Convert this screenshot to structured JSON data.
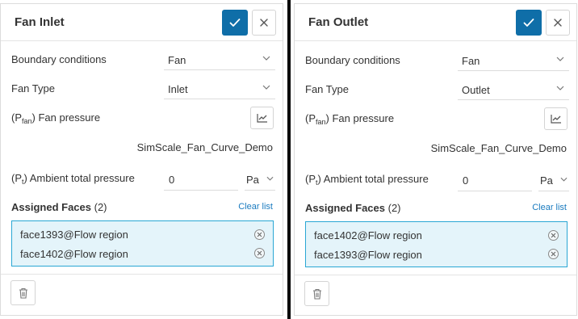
{
  "panels": [
    {
      "title": "Fan Inlet",
      "boundary_conditions_label": "Boundary conditions",
      "boundary_conditions_value": "Fan",
      "fan_type_label": "Fan Type",
      "fan_type_value": "Inlet",
      "fan_pressure_prefix": "(P",
      "fan_pressure_sub": "fan",
      "fan_pressure_suffix": ") Fan pressure",
      "fan_curve": "SimScale_Fan_Curve_Demo",
      "ambient_prefix": "(P",
      "ambient_sub": "t",
      "ambient_suffix": ") Ambient total pressure",
      "ambient_value": "0",
      "ambient_unit": "Pa",
      "assigned_label": "Assigned Faces",
      "assigned_count": "(2)",
      "clear_label": "Clear list",
      "faces": [
        "face1393@Flow region",
        "face1402@Flow region"
      ]
    },
    {
      "title": "Fan Outlet",
      "boundary_conditions_label": "Boundary conditions",
      "boundary_conditions_value": "Fan",
      "fan_type_label": "Fan Type",
      "fan_type_value": "Outlet",
      "fan_pressure_prefix": "(P",
      "fan_pressure_sub": "fan",
      "fan_pressure_suffix": ") Fan pressure",
      "fan_curve": "SimScale_Fan_Curve_Demo",
      "ambient_prefix": "(P",
      "ambient_sub": "t",
      "ambient_suffix": ") Ambient total pressure",
      "ambient_value": "0",
      "ambient_unit": "Pa",
      "assigned_label": "Assigned Faces",
      "assigned_count": "(2)",
      "clear_label": "Clear list",
      "faces": [
        "face1402@Flow region",
        "face1393@Flow region"
      ]
    }
  ],
  "icons": {
    "confirm": "check-icon",
    "close": "close-icon",
    "dropdown": "chevron-down-icon",
    "chart": "chart-icon",
    "remove": "remove-circle-icon",
    "delete": "trash-icon"
  },
  "colors": {
    "primary": "#0f6ea8",
    "link": "#1a7bbf",
    "selection_bg": "#e4f4fa",
    "selection_border": "#2aa7d4"
  }
}
